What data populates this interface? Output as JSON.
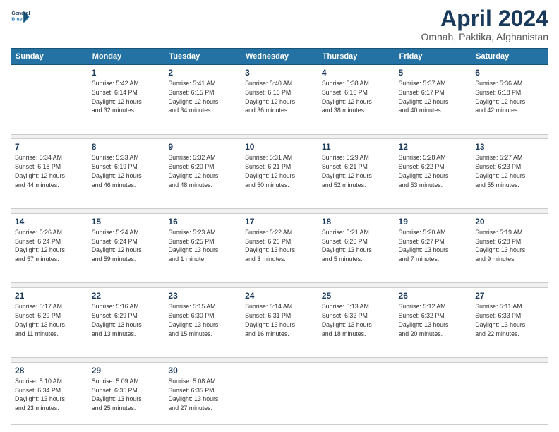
{
  "logo": {
    "line1": "General",
    "line2": "Blue"
  },
  "title": "April 2024",
  "location": "Omnah, Paktika, Afghanistan",
  "days_of_week": [
    "Sunday",
    "Monday",
    "Tuesday",
    "Wednesday",
    "Thursday",
    "Friday",
    "Saturday"
  ],
  "weeks": [
    {
      "days": [
        {
          "num": "",
          "info": ""
        },
        {
          "num": "1",
          "info": "Sunrise: 5:42 AM\nSunset: 6:14 PM\nDaylight: 12 hours\nand 32 minutes."
        },
        {
          "num": "2",
          "info": "Sunrise: 5:41 AM\nSunset: 6:15 PM\nDaylight: 12 hours\nand 34 minutes."
        },
        {
          "num": "3",
          "info": "Sunrise: 5:40 AM\nSunset: 6:16 PM\nDaylight: 12 hours\nand 36 minutes."
        },
        {
          "num": "4",
          "info": "Sunrise: 5:38 AM\nSunset: 6:16 PM\nDaylight: 12 hours\nand 38 minutes."
        },
        {
          "num": "5",
          "info": "Sunrise: 5:37 AM\nSunset: 6:17 PM\nDaylight: 12 hours\nand 40 minutes."
        },
        {
          "num": "6",
          "info": "Sunrise: 5:36 AM\nSunset: 6:18 PM\nDaylight: 12 hours\nand 42 minutes."
        }
      ]
    },
    {
      "days": [
        {
          "num": "7",
          "info": "Sunrise: 5:34 AM\nSunset: 6:18 PM\nDaylight: 12 hours\nand 44 minutes."
        },
        {
          "num": "8",
          "info": "Sunrise: 5:33 AM\nSunset: 6:19 PM\nDaylight: 12 hours\nand 46 minutes."
        },
        {
          "num": "9",
          "info": "Sunrise: 5:32 AM\nSunset: 6:20 PM\nDaylight: 12 hours\nand 48 minutes."
        },
        {
          "num": "10",
          "info": "Sunrise: 5:31 AM\nSunset: 6:21 PM\nDaylight: 12 hours\nand 50 minutes."
        },
        {
          "num": "11",
          "info": "Sunrise: 5:29 AM\nSunset: 6:21 PM\nDaylight: 12 hours\nand 52 minutes."
        },
        {
          "num": "12",
          "info": "Sunrise: 5:28 AM\nSunset: 6:22 PM\nDaylight: 12 hours\nand 53 minutes."
        },
        {
          "num": "13",
          "info": "Sunrise: 5:27 AM\nSunset: 6:23 PM\nDaylight: 12 hours\nand 55 minutes."
        }
      ]
    },
    {
      "days": [
        {
          "num": "14",
          "info": "Sunrise: 5:26 AM\nSunset: 6:24 PM\nDaylight: 12 hours\nand 57 minutes."
        },
        {
          "num": "15",
          "info": "Sunrise: 5:24 AM\nSunset: 6:24 PM\nDaylight: 12 hours\nand 59 minutes."
        },
        {
          "num": "16",
          "info": "Sunrise: 5:23 AM\nSunset: 6:25 PM\nDaylight: 13 hours\nand 1 minute."
        },
        {
          "num": "17",
          "info": "Sunrise: 5:22 AM\nSunset: 6:26 PM\nDaylight: 13 hours\nand 3 minutes."
        },
        {
          "num": "18",
          "info": "Sunrise: 5:21 AM\nSunset: 6:26 PM\nDaylight: 13 hours\nand 5 minutes."
        },
        {
          "num": "19",
          "info": "Sunrise: 5:20 AM\nSunset: 6:27 PM\nDaylight: 13 hours\nand 7 minutes."
        },
        {
          "num": "20",
          "info": "Sunrise: 5:19 AM\nSunset: 6:28 PM\nDaylight: 13 hours\nand 9 minutes."
        }
      ]
    },
    {
      "days": [
        {
          "num": "21",
          "info": "Sunrise: 5:17 AM\nSunset: 6:29 PM\nDaylight: 13 hours\nand 11 minutes."
        },
        {
          "num": "22",
          "info": "Sunrise: 5:16 AM\nSunset: 6:29 PM\nDaylight: 13 hours\nand 13 minutes."
        },
        {
          "num": "23",
          "info": "Sunrise: 5:15 AM\nSunset: 6:30 PM\nDaylight: 13 hours\nand 15 minutes."
        },
        {
          "num": "24",
          "info": "Sunrise: 5:14 AM\nSunset: 6:31 PM\nDaylight: 13 hours\nand 16 minutes."
        },
        {
          "num": "25",
          "info": "Sunrise: 5:13 AM\nSunset: 6:32 PM\nDaylight: 13 hours\nand 18 minutes."
        },
        {
          "num": "26",
          "info": "Sunrise: 5:12 AM\nSunset: 6:32 PM\nDaylight: 13 hours\nand 20 minutes."
        },
        {
          "num": "27",
          "info": "Sunrise: 5:11 AM\nSunset: 6:33 PM\nDaylight: 13 hours\nand 22 minutes."
        }
      ]
    },
    {
      "days": [
        {
          "num": "28",
          "info": "Sunrise: 5:10 AM\nSunset: 6:34 PM\nDaylight: 13 hours\nand 23 minutes."
        },
        {
          "num": "29",
          "info": "Sunrise: 5:09 AM\nSunset: 6:35 PM\nDaylight: 13 hours\nand 25 minutes."
        },
        {
          "num": "30",
          "info": "Sunrise: 5:08 AM\nSunset: 6:35 PM\nDaylight: 13 hours\nand 27 minutes."
        },
        {
          "num": "",
          "info": ""
        },
        {
          "num": "",
          "info": ""
        },
        {
          "num": "",
          "info": ""
        },
        {
          "num": "",
          "info": ""
        }
      ]
    }
  ]
}
